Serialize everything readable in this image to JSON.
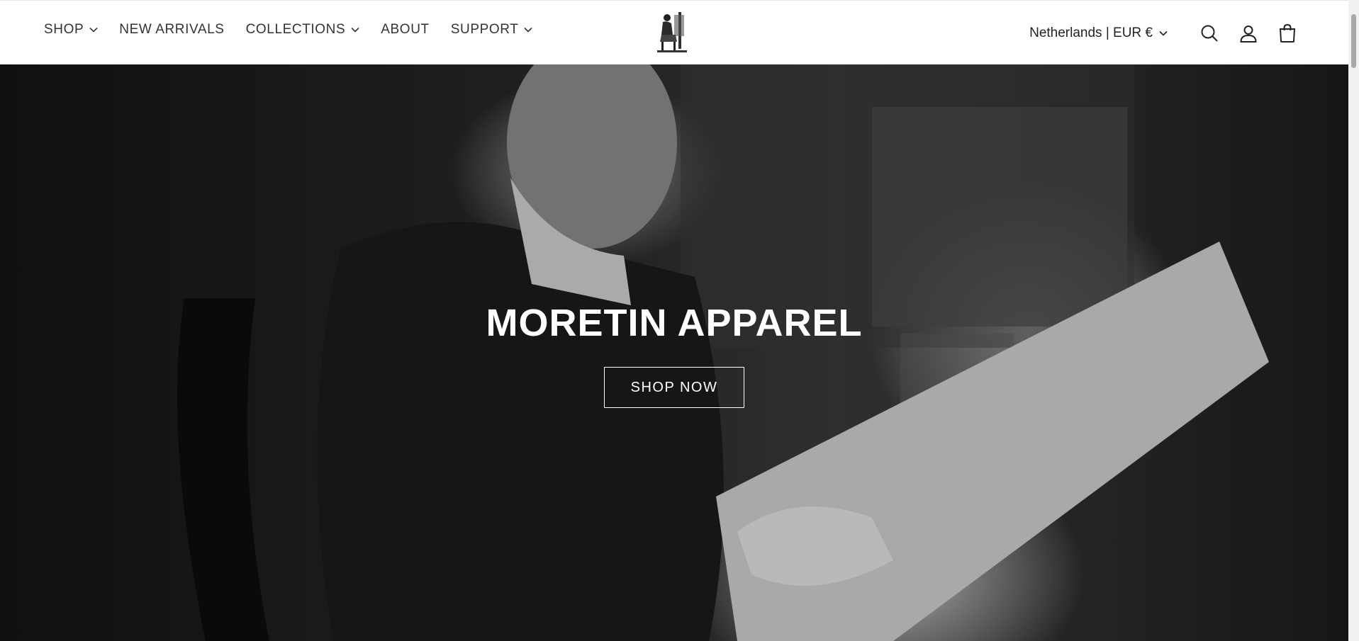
{
  "header": {
    "nav": [
      {
        "label": "SHOP",
        "has_dropdown": true
      },
      {
        "label": "NEW ARRIVALS",
        "has_dropdown": false
      },
      {
        "label": "COLLECTIONS",
        "has_dropdown": true
      },
      {
        "label": "ABOUT",
        "has_dropdown": false
      },
      {
        "label": "SUPPORT",
        "has_dropdown": true
      }
    ],
    "locale": "Netherlands | EUR €",
    "icons": [
      "search-icon",
      "account-icon",
      "cart-icon"
    ]
  },
  "hero": {
    "title": "MORETIN APPAREL",
    "cta_label": "SHOP NOW"
  },
  "colors": {
    "header_bg": "#ffffff",
    "nav_text": "#333333",
    "hero_text": "#ffffff"
  }
}
